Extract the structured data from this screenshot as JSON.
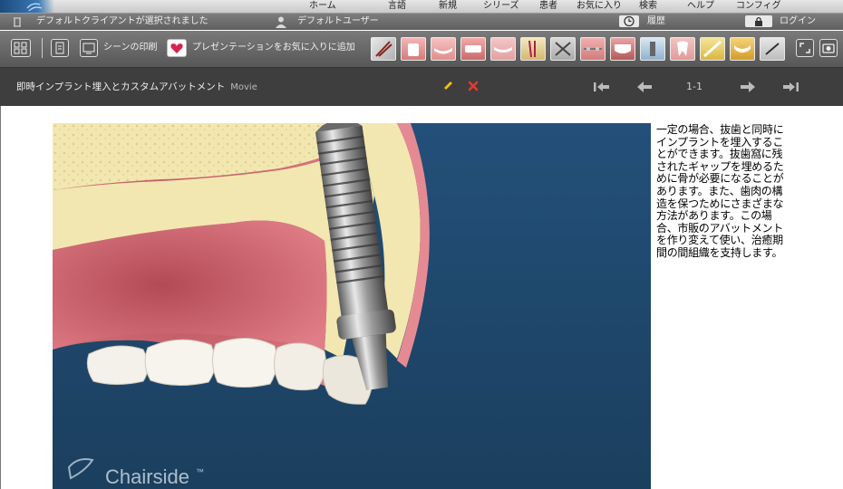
{
  "nav": {
    "items": [
      "ホーム",
      "言語",
      "新規",
      "シリーズ",
      "患者",
      "お気に入り",
      "検索",
      "ヘルプ",
      "コンフィグ"
    ]
  },
  "status": {
    "client": "デフォルトクライアントが選択されました",
    "user": "デフォルトユーザー",
    "history": "履歴",
    "login": "ログイン"
  },
  "toolbar": {
    "print_label": "シーンの印刷",
    "favorite_label": "プレゼンテーションをお気に入りに追加"
  },
  "titlebar": {
    "title": "即時インプラント埋入とカスタムアバットメント",
    "type": "Movie",
    "page": "1-1"
  },
  "video": {
    "watermark": "Chairside",
    "trademark": "™"
  },
  "description": "一定の場合、抜歯と同時にインプラントを埋入することができます。抜歯窩に残されたギャップを埋めるために骨が必要になることがあります。また、歯肉の構造を保つためにさまざまな方法があります。この場合、市販のアバットメントを作り変えて使い、治癒期間の間組織を支持します。",
  "colors": {
    "toolbar": "#5f5f5f",
    "titlebar": "#3e3e3e",
    "video_bg": "#214a6b",
    "gum": "#d9737e",
    "bone": "#f2e7b0",
    "edit_icon": "#f4c20d",
    "delete_icon": "#e23b2b"
  }
}
